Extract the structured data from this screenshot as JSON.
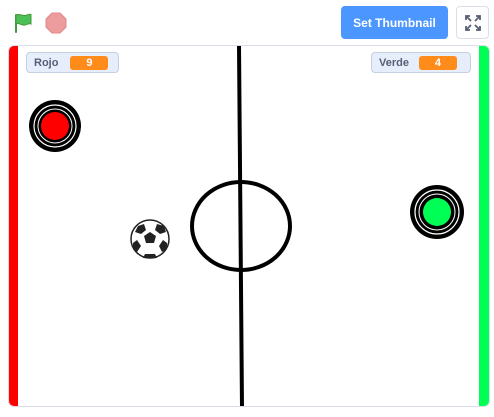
{
  "toolbar": {
    "thumbnail_label": "Set Thumbnail",
    "flag_icon": "green-flag-icon",
    "stop_icon": "stop-sign-icon",
    "fullscreen_icon": "fullscreen-icon"
  },
  "monitors": {
    "left": {
      "label": "Rojo",
      "value": "9"
    },
    "right": {
      "label": "Verde",
      "value": "4"
    }
  },
  "colors": {
    "flag": "#4cbf56",
    "stop": "#ec9c9c",
    "button": "#4c97ff",
    "monitor_value": "#ff8c1a",
    "red_goal": "#ff0000",
    "green_goal": "#00ff55"
  }
}
